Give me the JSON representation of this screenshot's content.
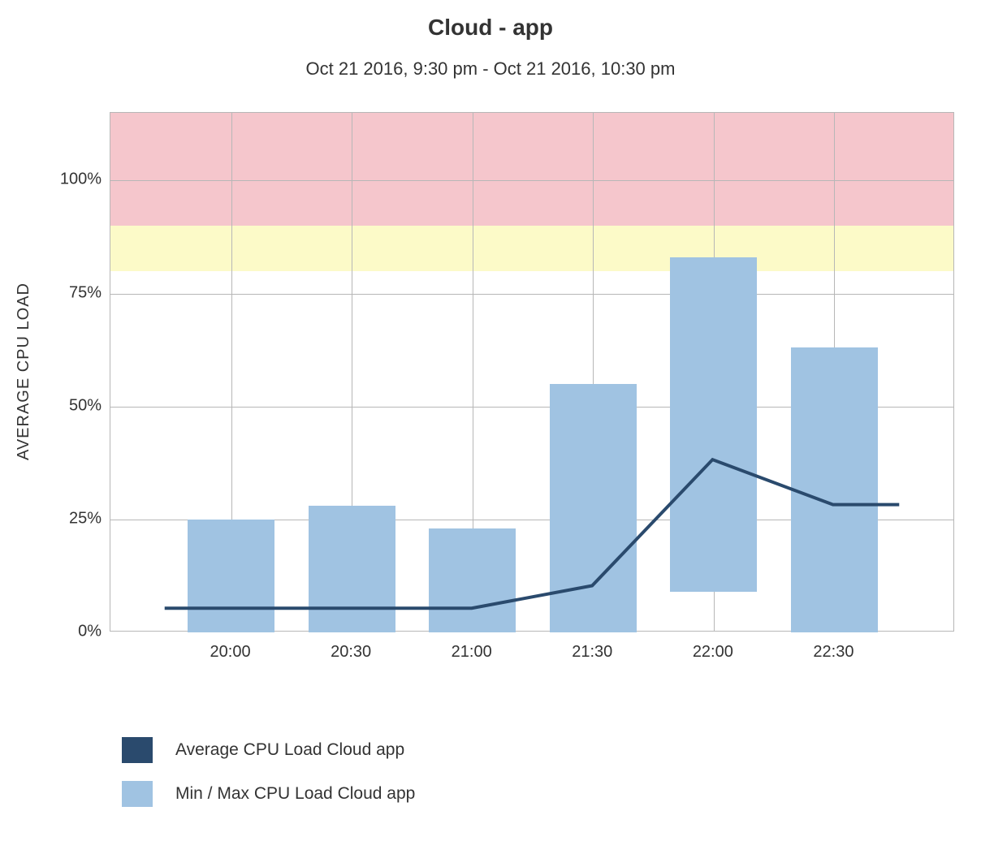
{
  "title": "Cloud - app",
  "subtitle": "Oct 21 2016, 9:30 pm - Oct 21 2016, 10:30 pm",
  "ylabel": "AVERAGE CPU LOAD",
  "y_ticks": [
    "0%",
    "25%",
    "50%",
    "75%",
    "100%"
  ],
  "x_ticks": [
    "20:00",
    "20:30",
    "21:00",
    "21:30",
    "22:00",
    "22:30"
  ],
  "legend": {
    "avg_color": "#2a4a6d",
    "avg_label": "Average CPU Load Cloud app",
    "range_color": "#a0c3e2",
    "range_label": "Min / Max CPU Load Cloud app"
  },
  "chart_data": {
    "type": "bar",
    "title": "Cloud - app",
    "subtitle": "Oct 21 2016, 9:30 pm - Oct 21 2016, 10:30 pm",
    "xlabel": "",
    "ylabel": "AVERAGE CPU LOAD",
    "ylim": [
      0,
      115
    ],
    "categories": [
      "20:00",
      "20:30",
      "21:00",
      "21:30",
      "22:00",
      "22:30"
    ],
    "series": [
      {
        "name": "Min CPU Load",
        "values": [
          0,
          0,
          0,
          0,
          9,
          0
        ]
      },
      {
        "name": "Max CPU Load",
        "values": [
          25,
          28,
          23,
          55,
          83,
          63
        ]
      },
      {
        "name": "Average CPU Load",
        "values": [
          5,
          5,
          5,
          10,
          38,
          28
        ]
      }
    ],
    "threshold_bands": [
      {
        "name": "warning",
        "from": 80,
        "to": 90,
        "color": "#fcfac8"
      },
      {
        "name": "critical",
        "from": 90,
        "to": 115,
        "color": "#f5c6cc"
      }
    ],
    "legend_entries": [
      "Average CPU Load Cloud app",
      "Min / Max CPU Load Cloud app"
    ],
    "grid": true
  }
}
